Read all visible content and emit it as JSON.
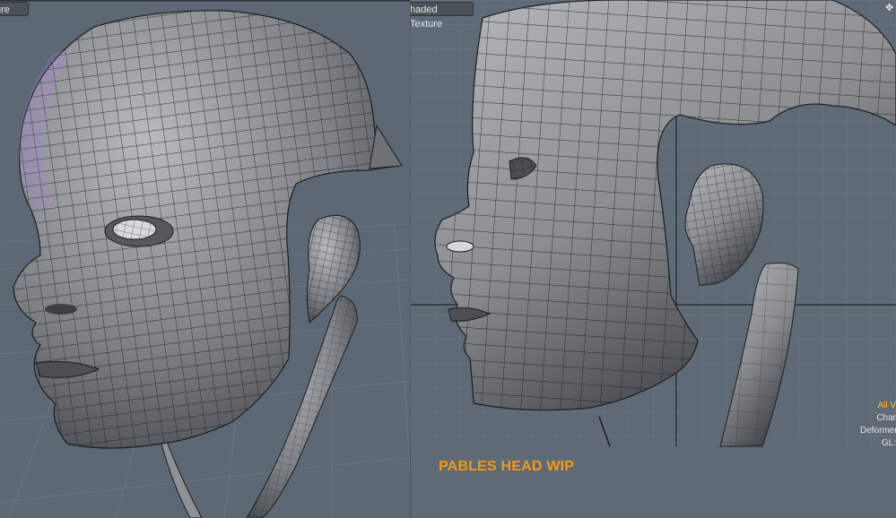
{
  "viewports": {
    "left": {
      "tab_label": "ure"
    },
    "right": {
      "tab_label": "haded Texture",
      "corner_icon": "move-cross-icon"
    }
  },
  "hud": {
    "all": "All V",
    "char": "Char",
    "deformer": "Deformer",
    "gl": "GL:"
  },
  "caption": "PABLES HEAD WIP",
  "colors": {
    "caption": "#f29a16",
    "hud_highlight": "#ffc21a",
    "viewport_bg": "#5f6a76",
    "mesh_fill": "#8a8d90",
    "mesh_wire": "#1b1d20",
    "selection": "#b37cff"
  }
}
